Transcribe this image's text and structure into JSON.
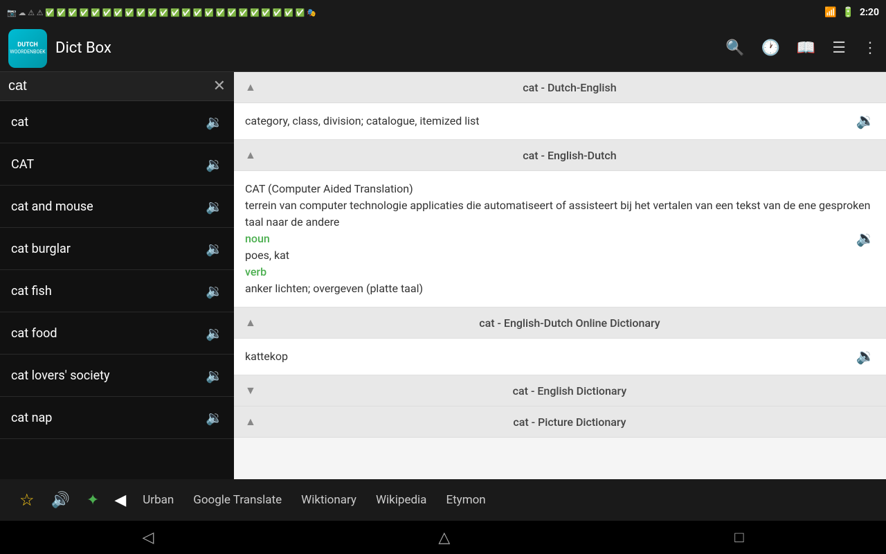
{
  "statusBar": {
    "time": "2:20",
    "icons": [
      "📶",
      "🔋"
    ]
  },
  "appBar": {
    "logoLine1": "DUTCH",
    "logoLine2": "WOORDENBOEK",
    "title": "Dict Box",
    "icons": [
      "search",
      "history",
      "book",
      "menu",
      "more"
    ]
  },
  "sidebar": {
    "searchValue": "cat",
    "items": [
      {
        "text": "cat"
      },
      {
        "text": "CAT"
      },
      {
        "text": "cat and mouse"
      },
      {
        "text": "cat burglar"
      },
      {
        "text": "cat fish"
      },
      {
        "text": "cat food"
      },
      {
        "text": "cat lovers' society"
      },
      {
        "text": "cat nap"
      }
    ]
  },
  "sections": [
    {
      "id": "dutch-english",
      "title": "cat - Dutch-English",
      "collapsed": false,
      "chevron": "up",
      "body": [
        {
          "type": "text",
          "content": "category, class, division; catalogue, itemized list"
        }
      ],
      "hasSound": true
    },
    {
      "id": "english-dutch",
      "title": "cat - English-Dutch",
      "collapsed": false,
      "chevron": "up",
      "body": [
        {
          "type": "text",
          "content": "CAT (Computer Aided Translation)"
        },
        {
          "type": "text",
          "content": "terrein van computer technologie applicaties die automatiseert of assisteert bij het vertalen van een tekst van de ene gesproken taal naar de andere"
        },
        {
          "type": "label-green",
          "content": "noun"
        },
        {
          "type": "text",
          "content": "poes, kat"
        },
        {
          "type": "label-green",
          "content": "verb"
        },
        {
          "type": "text",
          "content": "anker lichten; overgeven (platte taal)"
        }
      ],
      "hasSound": true
    },
    {
      "id": "online-dictionary",
      "title": "cat - English-Dutch Online Dictionary",
      "collapsed": false,
      "chevron": "up",
      "body": [
        {
          "type": "text",
          "content": "kattekop"
        }
      ],
      "hasSound": true
    },
    {
      "id": "english-dictionary",
      "title": "cat - English Dictionary",
      "collapsed": true,
      "chevron": "down",
      "body": [],
      "hasSound": false
    },
    {
      "id": "picture-dictionary",
      "title": "cat - Picture Dictionary",
      "collapsed": false,
      "chevron": "up",
      "body": [],
      "hasSound": false
    }
  ],
  "bottomToolbar": {
    "links": [
      "Urban",
      "Google Translate",
      "Wiktionary",
      "Wikipedia",
      "Etymon"
    ]
  },
  "navBar": {
    "back": "◀",
    "home": "⌂",
    "recents": "⬜"
  }
}
